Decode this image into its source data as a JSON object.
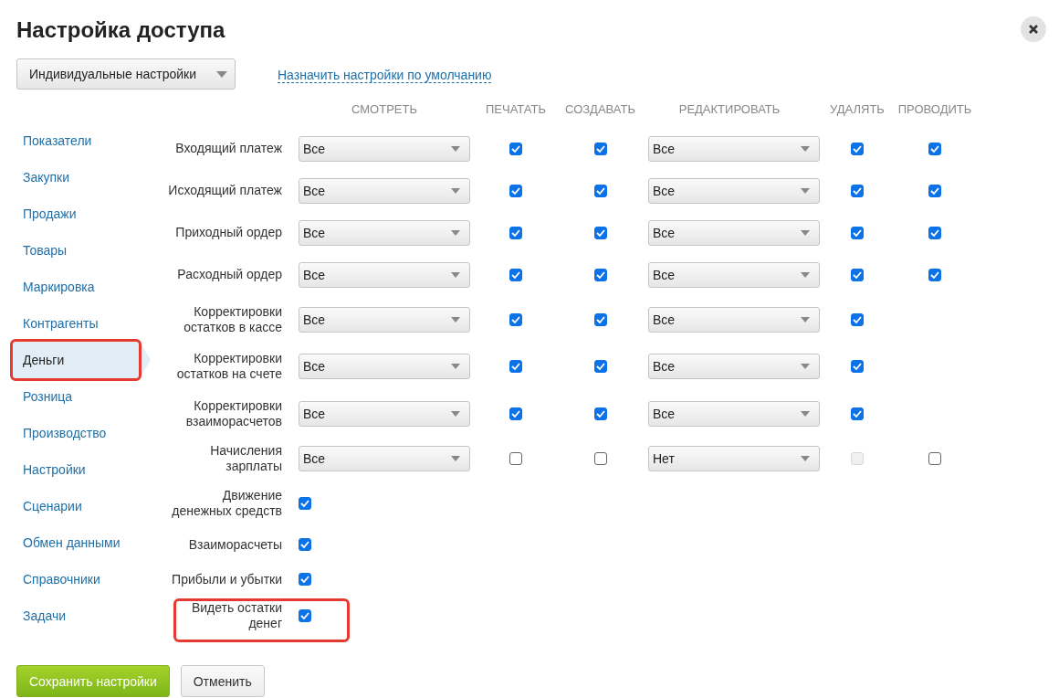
{
  "dialog": {
    "title": "Настройка доступа"
  },
  "mode_select": {
    "value": "Индивидуальные настройки"
  },
  "default_link": "Назначить настройки по умолчанию",
  "sidebar": {
    "items": [
      {
        "label": "Показатели",
        "selected": false,
        "highlighted": false
      },
      {
        "label": "Закупки",
        "selected": false,
        "highlighted": false
      },
      {
        "label": "Продажи",
        "selected": false,
        "highlighted": false
      },
      {
        "label": "Товары",
        "selected": false,
        "highlighted": false
      },
      {
        "label": "Маркировка",
        "selected": false,
        "highlighted": false
      },
      {
        "label": "Контрагенты",
        "selected": false,
        "highlighted": false
      },
      {
        "label": "Деньги",
        "selected": true,
        "highlighted": true
      },
      {
        "label": "Розница",
        "selected": false,
        "highlighted": false
      },
      {
        "label": "Производство",
        "selected": false,
        "highlighted": false
      },
      {
        "label": "Настройки",
        "selected": false,
        "highlighted": false
      },
      {
        "label": "Сценарии",
        "selected": false,
        "highlighted": false
      },
      {
        "label": "Обмен данными",
        "selected": false,
        "highlighted": false
      },
      {
        "label": "Справочники",
        "selected": false,
        "highlighted": false
      },
      {
        "label": "Задачи",
        "selected": false,
        "highlighted": false
      }
    ]
  },
  "table": {
    "columns": [
      "СМОТРЕТЬ",
      "ПЕЧАТАТЬ",
      "СОЗДАВАТЬ",
      "РЕДАКТИРОВАТЬ",
      "УДАЛЯТЬ",
      "ПРОВОДИТЬ"
    ],
    "rows": [
      {
        "kind": "full",
        "label": "Входящий платеж",
        "view": "Все",
        "print": {
          "checked": true,
          "disabled": false
        },
        "create": {
          "checked": true,
          "disabled": false
        },
        "edit": "Все",
        "delete": {
          "checked": true,
          "disabled": false
        },
        "post": {
          "checked": true,
          "disabled": false
        }
      },
      {
        "kind": "full",
        "label": "Исходящий платеж",
        "view": "Все",
        "print": {
          "checked": true,
          "disabled": false
        },
        "create": {
          "checked": true,
          "disabled": false
        },
        "edit": "Все",
        "delete": {
          "checked": true,
          "disabled": false
        },
        "post": {
          "checked": true,
          "disabled": false
        }
      },
      {
        "kind": "full",
        "label": "Приходный ордер",
        "view": "Все",
        "print": {
          "checked": true,
          "disabled": false
        },
        "create": {
          "checked": true,
          "disabled": false
        },
        "edit": "Все",
        "delete": {
          "checked": true,
          "disabled": false
        },
        "post": {
          "checked": true,
          "disabled": false
        }
      },
      {
        "kind": "full",
        "label": "Расходный ордер",
        "view": "Все",
        "print": {
          "checked": true,
          "disabled": false
        },
        "create": {
          "checked": true,
          "disabled": false
        },
        "edit": "Все",
        "delete": {
          "checked": true,
          "disabled": false
        },
        "post": {
          "checked": true,
          "disabled": false
        }
      },
      {
        "kind": "full",
        "label": "Корректировки остатков в кассе",
        "view": "Все",
        "print": {
          "checked": true,
          "disabled": false
        },
        "create": {
          "checked": true,
          "disabled": false
        },
        "edit": "Все",
        "delete": {
          "checked": true,
          "disabled": false
        }
      },
      {
        "kind": "full",
        "label": "Корректировки остатков на счете",
        "view": "Все",
        "print": {
          "checked": true,
          "disabled": false
        },
        "create": {
          "checked": true,
          "disabled": false
        },
        "edit": "Все",
        "delete": {
          "checked": true,
          "disabled": false
        }
      },
      {
        "kind": "full",
        "label": "Корректировки взаиморасчетов",
        "view": "Все",
        "print": {
          "checked": true,
          "disabled": false
        },
        "create": {
          "checked": true,
          "disabled": false
        },
        "edit": "Все",
        "delete": {
          "checked": true,
          "disabled": false
        }
      },
      {
        "kind": "full",
        "label": "Начисления зарплаты",
        "view": "Все",
        "print": {
          "checked": false,
          "disabled": false
        },
        "create": {
          "checked": false,
          "disabled": false
        },
        "edit": "Нет",
        "delete": {
          "checked": false,
          "disabled": true
        },
        "post": {
          "checked": false,
          "disabled": false
        }
      },
      {
        "kind": "simple",
        "label": "Движение денежных средств",
        "checked": true,
        "highlighted": false
      },
      {
        "kind": "simple",
        "label": "Взаиморасчеты",
        "checked": true,
        "highlighted": false
      },
      {
        "kind": "simple",
        "label": "Прибыли и убытки",
        "checked": true,
        "highlighted": false
      },
      {
        "kind": "simple",
        "label": "Видеть остатки денег",
        "checked": true,
        "highlighted": true
      }
    ]
  },
  "buttons": [
    {
      "kind": "primary",
      "label": "Сохранить настройки"
    },
    {
      "kind": "secondary",
      "label": "Отменить"
    }
  ]
}
